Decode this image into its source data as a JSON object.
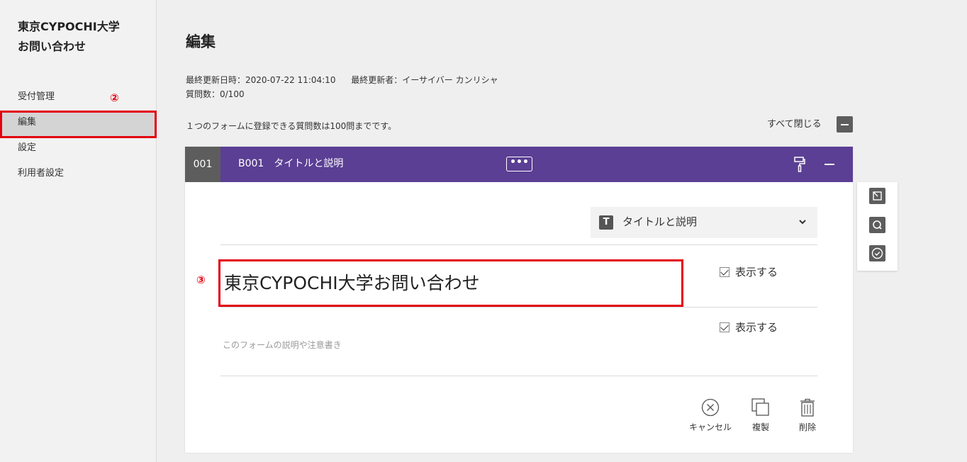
{
  "sidebar": {
    "title_line1": "東京CYPOCHI大学",
    "title_line2": "お問い合わせ",
    "items": [
      {
        "label": "受付管理"
      },
      {
        "label": "編集"
      },
      {
        "label": "設定"
      },
      {
        "label": "利用者設定"
      }
    ]
  },
  "annotations": {
    "marker2": "②",
    "marker3": "③",
    "highlight_color": "#e3000f"
  },
  "main": {
    "page_title": "編集",
    "last_updated": "最終更新日時：2020-07-22 11:04:10",
    "last_updater": "最終更新者：イーサイバー カンリシャ",
    "question_count": "質問数：0/100",
    "hint": "１つのフォームに登録できる質問数は100問までです。",
    "close_all": "すべて閉じる"
  },
  "card": {
    "number": "001",
    "header_title": "B001　タイトルと説明",
    "more": "•••",
    "header_color": "#5b3f94",
    "type_icon": "T",
    "type_label": "タイトルと説明",
    "title_value": "東京CYPOCHI大学お問い合わせ",
    "show_title": "表示する",
    "show_description": "表示する",
    "description_placeholder": "このフォームの説明や注意書き",
    "actions": {
      "cancel": "キャンセル",
      "duplicate": "複製",
      "delete": "削除"
    }
  },
  "tools": [
    "tab-icon",
    "search-icon",
    "check-circle-icon"
  ]
}
